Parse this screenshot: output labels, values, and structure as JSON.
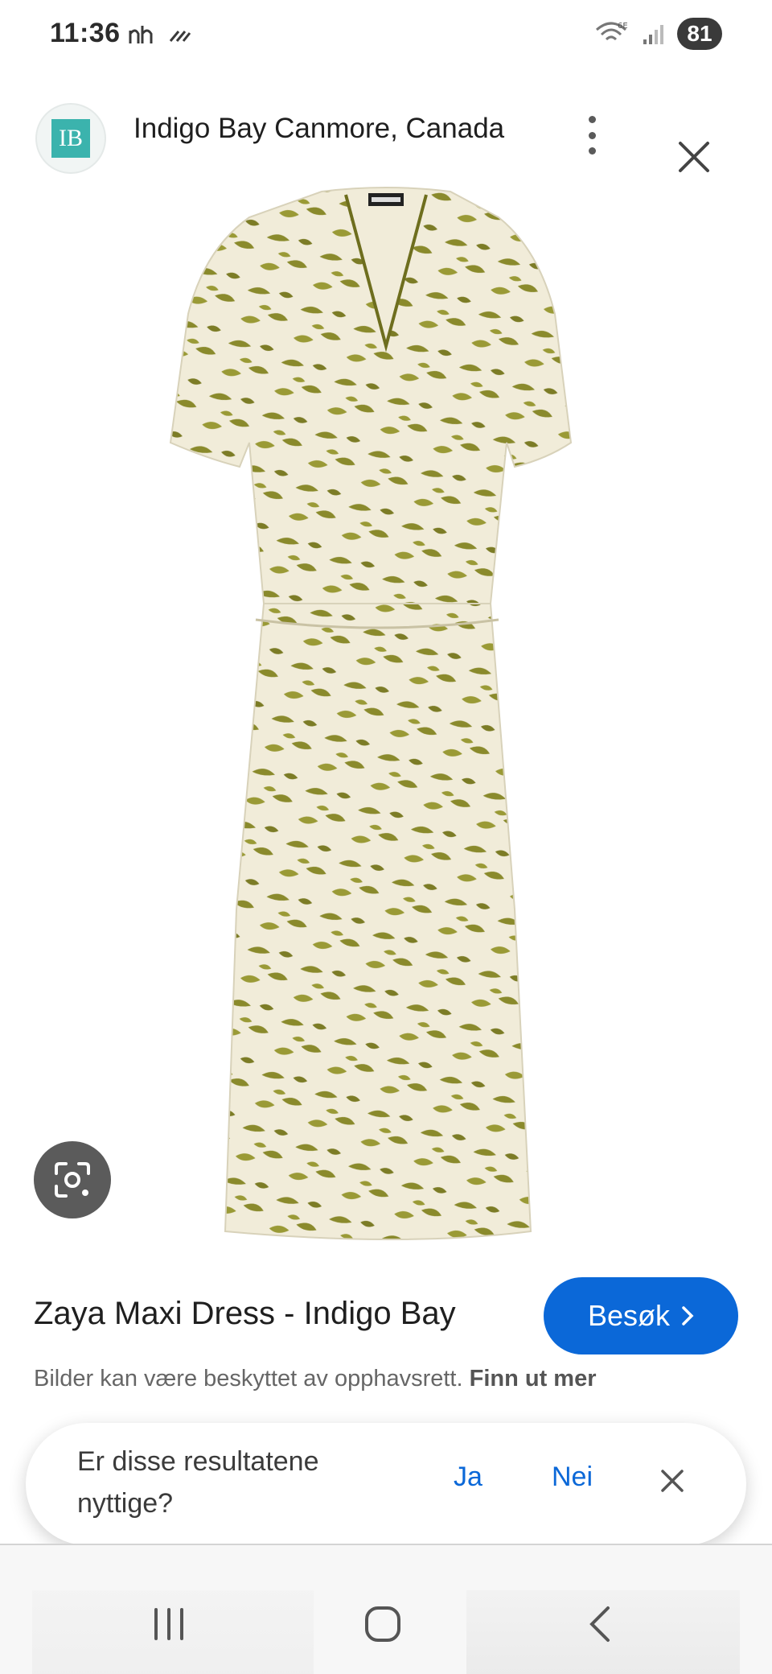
{
  "status_bar": {
    "time": "11:36",
    "battery": "81"
  },
  "header": {
    "site_name": "Indigo Bay Canmore, Canada",
    "logo_text": "IB"
  },
  "product": {
    "image_alt": "Zaya Maxi Dress",
    "title": "Zaya Maxi Dress - Indigo Bay",
    "visit_label": "Besøk",
    "copyright_text": "Bilder kan være beskyttet av opphavsrett.",
    "learn_more": "Finn ut mer"
  },
  "feedback": {
    "question": "Er disse resultatene nyttige?",
    "yes": "Ja",
    "no": "Nei"
  },
  "colors": {
    "accent": "#0b68d8",
    "dress_base": "#f1ecd9",
    "dress_print": "#8a8a2c"
  }
}
